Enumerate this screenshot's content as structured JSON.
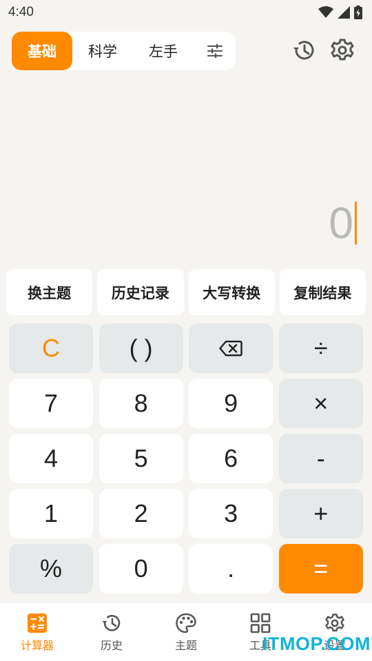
{
  "status": {
    "time": "4:40"
  },
  "mode_tabs": [
    {
      "label": "基础",
      "active": true
    },
    {
      "label": "科学",
      "active": false
    },
    {
      "label": "左手",
      "active": false
    }
  ],
  "icons": {
    "settings_tab": "sliders-icon",
    "history": "history-icon",
    "settings": "gear-icon"
  },
  "display": {
    "value": "0"
  },
  "quick_actions": [
    "换主题",
    "历史记录",
    "大写转换",
    "复制结果"
  ],
  "keys": [
    [
      "C",
      "( )",
      "backspace",
      "÷"
    ],
    [
      "7",
      "8",
      "9",
      "×"
    ],
    [
      "4",
      "5",
      "6",
      "-"
    ],
    [
      "1",
      "2",
      "3",
      "+"
    ],
    [
      "%",
      "0",
      ".",
      "="
    ]
  ],
  "bottom_nav": [
    {
      "label": "计算器",
      "icon": "calculator-icon",
      "active": true
    },
    {
      "label": "历史",
      "icon": "history-icon",
      "active": false
    },
    {
      "label": "主题",
      "icon": "palette-icon",
      "active": false
    },
    {
      "label": "工具",
      "icon": "grid-icon",
      "active": false
    },
    {
      "label": "设置",
      "icon": "gear-icon",
      "active": false
    }
  ],
  "watermark": "ITMOP.COM",
  "colors": {
    "accent": "#ff8a00",
    "background": "#f5f4f1",
    "key_gray": "#e5e9ea"
  }
}
